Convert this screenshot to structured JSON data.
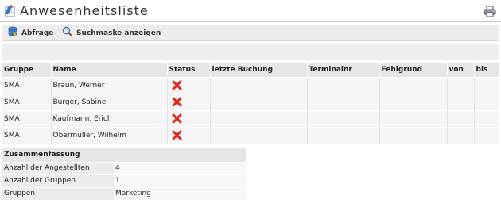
{
  "page": {
    "title": "Anwesenheitsliste",
    "title_icon": "report-list-icon",
    "print_icon": "print-icon"
  },
  "toolbar": {
    "abfrage_label": "Abfrage",
    "such_label": "Suchmaske anzeigen"
  },
  "table": {
    "headers": [
      "Gruppe",
      "Name",
      "Status",
      "letzte Buchung",
      "Terminalnr",
      "Fehlgrund",
      "von",
      "bis"
    ],
    "rows": [
      {
        "gruppe": "SMA",
        "name": "Braun, Werner",
        "status": "absent"
      },
      {
        "gruppe": "SMA",
        "name": "Burger, Sabine",
        "status": "absent"
      },
      {
        "gruppe": "SMA",
        "name": "Kaufmann, Erich",
        "status": "absent"
      },
      {
        "gruppe": "SMA",
        "name": "Obermüller, Wilhelm",
        "status": "absent"
      }
    ],
    "status_color": "#e0281c"
  },
  "summary": {
    "heading": "Zusammenfassung",
    "rows": [
      {
        "label": "Anzahl der Angestellten",
        "value": "4"
      },
      {
        "label": "Anzahl der Gruppen",
        "value": "1"
      },
      {
        "label": "Gruppen",
        "value": "Marketing"
      }
    ]
  }
}
